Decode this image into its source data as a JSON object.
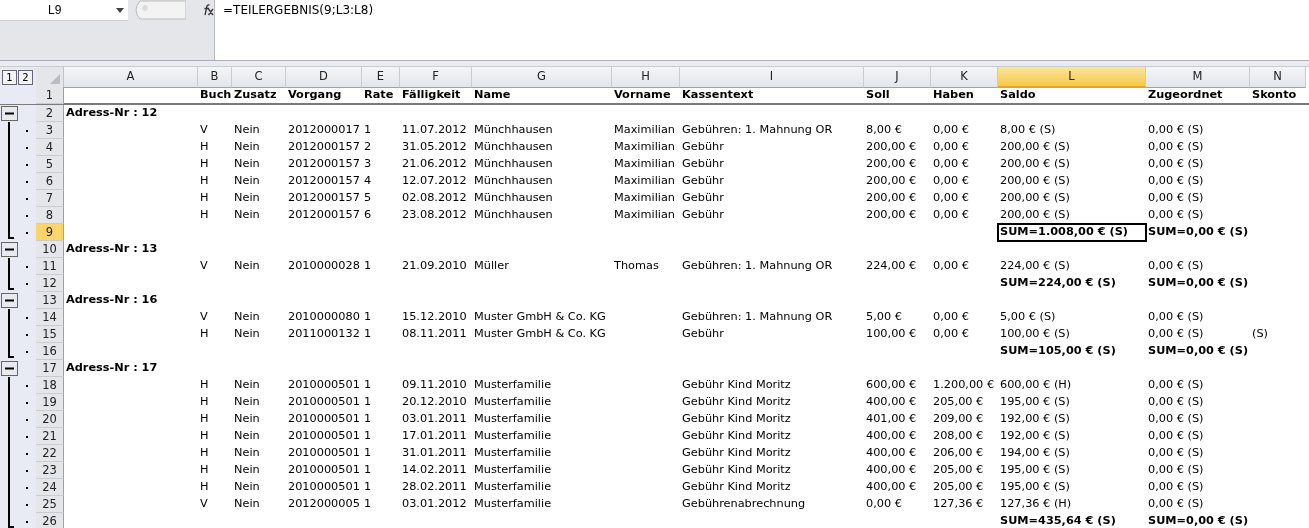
{
  "formula_bar": {
    "name_box": "L9",
    "formula": "=TEILERGEBNIS(9;L3:L8)"
  },
  "outline_levels": [
    "1",
    "2"
  ],
  "columns": [
    {
      "label": "A",
      "selected": false
    },
    {
      "label": "B",
      "selected": false
    },
    {
      "label": "C",
      "selected": false
    },
    {
      "label": "D",
      "selected": false
    },
    {
      "label": "E",
      "selected": false
    },
    {
      "label": "F",
      "selected": false
    },
    {
      "label": "G",
      "selected": false
    },
    {
      "label": "H",
      "selected": false
    },
    {
      "label": "I",
      "selected": false
    },
    {
      "label": "J",
      "selected": false
    },
    {
      "label": "K",
      "selected": false
    },
    {
      "label": "L",
      "selected": true
    },
    {
      "label": "M",
      "selected": false
    },
    {
      "label": "N",
      "selected": false
    }
  ],
  "header_row": {
    "number": "1",
    "selected": false,
    "cells": {
      "B": "Buch",
      "C": "Zusatz",
      "D": "Vorgang",
      "E": "Rate",
      "F": "Fälligkeit",
      "G": "Name",
      "H": "Vorname",
      "I": "Kassentext",
      "J": "Soll",
      "K": "Haben",
      "L": "Saldo",
      "M": "Zugeordnet",
      "N": "Skonto"
    }
  },
  "groups": [
    {
      "expanded": true,
      "title_row": {
        "number": "2",
        "selected": false,
        "cells": {
          "A": "Adress-Nr : 12"
        }
      },
      "children": [
        {
          "number": "3",
          "kind": "data",
          "selected": false,
          "cells": {
            "B": "V",
            "C": "Nein",
            "D": "2012000017",
            "E": "1",
            "F": "11.07.2012",
            "G": "Münchhausen",
            "H": "Maximilian",
            "I": "Gebühren: 1. Mahnung OR",
            "J": "8,00 €",
            "K": "0,00 €",
            "L": "8,00 € (S)",
            "M": "0,00 € (S)"
          }
        },
        {
          "number": "4",
          "kind": "data",
          "selected": false,
          "cells": {
            "B": "H",
            "C": "Nein",
            "D": "2012000157",
            "E": "2",
            "F": "31.05.2012",
            "G": "Münchhausen",
            "H": "Maximilian",
            "I": "Gebühr",
            "J": "200,00 €",
            "K": "0,00 €",
            "L": "200,00 € (S)",
            "M": "0,00 € (S)"
          }
        },
        {
          "number": "5",
          "kind": "data",
          "selected": false,
          "cells": {
            "B": "H",
            "C": "Nein",
            "D": "2012000157",
            "E": "3",
            "F": "21.06.2012",
            "G": "Münchhausen",
            "H": "Maximilian",
            "I": "Gebühr",
            "J": "200,00 €",
            "K": "0,00 €",
            "L": "200,00 € (S)",
            "M": "0,00 € (S)"
          }
        },
        {
          "number": "6",
          "kind": "data",
          "selected": false,
          "cells": {
            "B": "H",
            "C": "Nein",
            "D": "2012000157",
            "E": "4",
            "F": "12.07.2012",
            "G": "Münchhausen",
            "H": "Maximilian",
            "I": "Gebühr",
            "J": "200,00 €",
            "K": "0,00 €",
            "L": "200,00 € (S)",
            "M": "0,00 € (S)"
          }
        },
        {
          "number": "7",
          "kind": "data",
          "selected": false,
          "cells": {
            "B": "H",
            "C": "Nein",
            "D": "2012000157",
            "E": "5",
            "F": "02.08.2012",
            "G": "Münchhausen",
            "H": "Maximilian",
            "I": "Gebühr",
            "J": "200,00 €",
            "K": "0,00 €",
            "L": "200,00 € (S)",
            "M": "0,00 € (S)"
          }
        },
        {
          "number": "8",
          "kind": "data",
          "selected": false,
          "cells": {
            "B": "H",
            "C": "Nein",
            "D": "2012000157",
            "E": "6",
            "F": "23.08.2012",
            "G": "Münchhausen",
            "H": "Maximilian",
            "I": "Gebühr",
            "J": "200,00 €",
            "K": "0,00 €",
            "L": "200,00 € (S)",
            "M": "0,00 € (S)"
          }
        },
        {
          "number": "9",
          "kind": "sum",
          "selected": true,
          "cells": {
            "L": "SUM=1.008,00 € (S)",
            "M": "SUM=0,00 € (S)"
          }
        }
      ]
    },
    {
      "expanded": true,
      "title_row": {
        "number": "10",
        "selected": false,
        "cells": {
          "A": "Adress-Nr : 13"
        }
      },
      "children": [
        {
          "number": "11",
          "kind": "data",
          "selected": false,
          "cells": {
            "B": "V",
            "C": "Nein",
            "D": "2010000028",
            "E": "1",
            "F": "21.09.2010",
            "G": "Müller",
            "H": "Thomas",
            "I": "Gebühren: 1. Mahnung OR",
            "J": "224,00 €",
            "K": "0,00 €",
            "L": "224,00 € (S)",
            "M": "0,00 € (S)"
          }
        },
        {
          "number": "12",
          "kind": "sum",
          "selected": false,
          "cells": {
            "L": "SUM=224,00 € (S)",
            "M": "SUM=0,00 € (S)"
          }
        }
      ]
    },
    {
      "expanded": true,
      "title_row": {
        "number": "13",
        "selected": false,
        "cells": {
          "A": "Adress-Nr : 16"
        }
      },
      "children": [
        {
          "number": "14",
          "kind": "data",
          "selected": false,
          "cells": {
            "B": "V",
            "C": "Nein",
            "D": "2010000080",
            "E": "1",
            "F": "15.12.2010",
            "G": "Muster GmbH & Co. KG",
            "I": "Gebühren: 1. Mahnung OR",
            "J": "5,00 €",
            "K": "0,00 €",
            "L": "5,00 € (S)",
            "M": "0,00 € (S)"
          }
        },
        {
          "number": "15",
          "kind": "data",
          "selected": false,
          "cells": {
            "B": "H",
            "C": "Nein",
            "D": "2011000132",
            "E": "1",
            "F": "08.11.2011",
            "G": "Muster GmbH & Co. KG",
            "I": "Gebühr",
            "J": "100,00 €",
            "K": "0,00 €",
            "L": "100,00 € (S)",
            "M": "0,00 € (S)",
            "N": "(S)"
          }
        },
        {
          "number": "16",
          "kind": "sum",
          "selected": false,
          "cells": {
            "L": "SUM=105,00 € (S)",
            "M": "SUM=0,00 € (S)"
          }
        }
      ]
    },
    {
      "expanded": true,
      "title_row": {
        "number": "17",
        "selected": false,
        "cells": {
          "A": "Adress-Nr : 17"
        }
      },
      "children": [
        {
          "number": "18",
          "kind": "data",
          "selected": false,
          "cells": {
            "B": "H",
            "C": "Nein",
            "D": "2010000501",
            "E": "1",
            "F": "09.11.2010",
            "G": "Musterfamilie",
            "I": "Gebühr Kind Moritz",
            "J": "600,00 €",
            "K": "1.200,00 €",
            "L": "600,00 € (H)",
            "M": "0,00 € (S)"
          }
        },
        {
          "number": "19",
          "kind": "data",
          "selected": false,
          "cells": {
            "B": "H",
            "C": "Nein",
            "D": "2010000501",
            "E": "1",
            "F": "20.12.2010",
            "G": "Musterfamilie",
            "I": "Gebühr Kind Moritz",
            "J": "400,00 €",
            "K": "205,00 €",
            "L": "195,00 € (S)",
            "M": "0,00 € (S)"
          }
        },
        {
          "number": "20",
          "kind": "data",
          "selected": false,
          "cells": {
            "B": "H",
            "C": "Nein",
            "D": "2010000501",
            "E": "1",
            "F": "03.01.2011",
            "G": "Musterfamilie",
            "I": "Gebühr Kind Moritz",
            "J": "401,00 €",
            "K": "209,00 €",
            "L": "192,00 € (S)",
            "M": "0,00 € (S)"
          }
        },
        {
          "number": "21",
          "kind": "data",
          "selected": false,
          "cells": {
            "B": "H",
            "C": "Nein",
            "D": "2010000501",
            "E": "1",
            "F": "17.01.2011",
            "G": "Musterfamilie",
            "I": "Gebühr Kind Moritz",
            "J": "400,00 €",
            "K": "208,00 €",
            "L": "192,00 € (S)",
            "M": "0,00 € (S)"
          }
        },
        {
          "number": "22",
          "kind": "data",
          "selected": false,
          "cells": {
            "B": "H",
            "C": "Nein",
            "D": "2010000501",
            "E": "1",
            "F": "31.01.2011",
            "G": "Musterfamilie",
            "I": "Gebühr Kind Moritz",
            "J": "400,00 €",
            "K": "206,00 €",
            "L": "194,00 € (S)",
            "M": "0,00 € (S)"
          }
        },
        {
          "number": "23",
          "kind": "data",
          "selected": false,
          "cells": {
            "B": "H",
            "C": "Nein",
            "D": "2010000501",
            "E": "1",
            "F": "14.02.2011",
            "G": "Musterfamilie",
            "I": "Gebühr Kind Moritz",
            "J": "400,00 €",
            "K": "205,00 €",
            "L": "195,00 € (S)",
            "M": "0,00 € (S)"
          }
        },
        {
          "number": "24",
          "kind": "data",
          "selected": false,
          "cells": {
            "B": "H",
            "C": "Nein",
            "D": "2010000501",
            "E": "1",
            "F": "28.02.2011",
            "G": "Musterfamilie",
            "I": "Gebühr Kind Moritz",
            "J": "400,00 €",
            "K": "205,00 €",
            "L": "195,00 € (S)",
            "M": "0,00 € (S)"
          }
        },
        {
          "number": "25",
          "kind": "data",
          "selected": false,
          "cells": {
            "B": "V",
            "C": "Nein",
            "D": "2012000005",
            "E": "1",
            "F": "03.01.2012",
            "G": "Musterfamilie",
            "I": "Gebührenabrechnung",
            "J": "0,00 €",
            "K": "127,36 €",
            "L": "127,36 € (H)",
            "M": "0,00 € (S)"
          }
        },
        {
          "number": "26",
          "kind": "sum",
          "selected": false,
          "cells": {
            "L": "SUM=435,64 € (S)",
            "M": "SUM=0,00 € (S)"
          }
        }
      ]
    }
  ]
}
